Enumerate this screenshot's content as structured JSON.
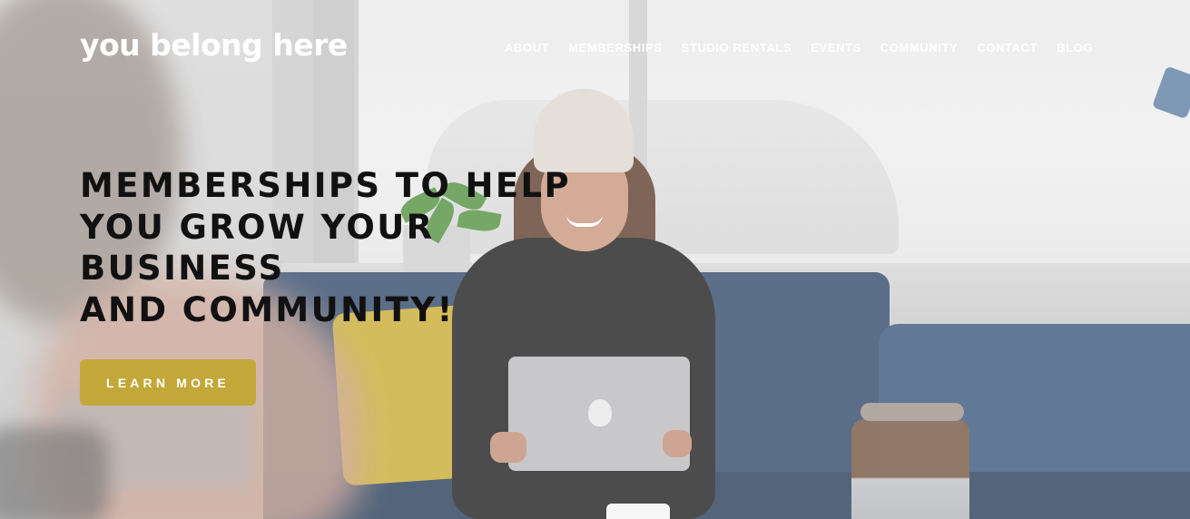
{
  "site": {
    "logo_text": "you belong here"
  },
  "nav": {
    "items": [
      {
        "label": "ABOUT"
      },
      {
        "label": "MEMBERSHIPS"
      },
      {
        "label": "STUDIO RENTALS"
      },
      {
        "label": "EVENTS"
      },
      {
        "label": "COMMUNITY"
      },
      {
        "label": "CONTACT"
      },
      {
        "label": "BLOG"
      }
    ]
  },
  "hero": {
    "headline_lines": [
      "MEMBERSHIPS TO HELP",
      "YOU GROW YOUR",
      "BUSINESS",
      "AND COMMUNITY!"
    ],
    "cta_label": "LEARN MORE",
    "background_image": "woman-smiling-with-laptop-on-blue-sofa",
    "colors": {
      "cta_background": "#c3a839",
      "headline": "#111111",
      "nav_text": "#ffffff"
    }
  }
}
